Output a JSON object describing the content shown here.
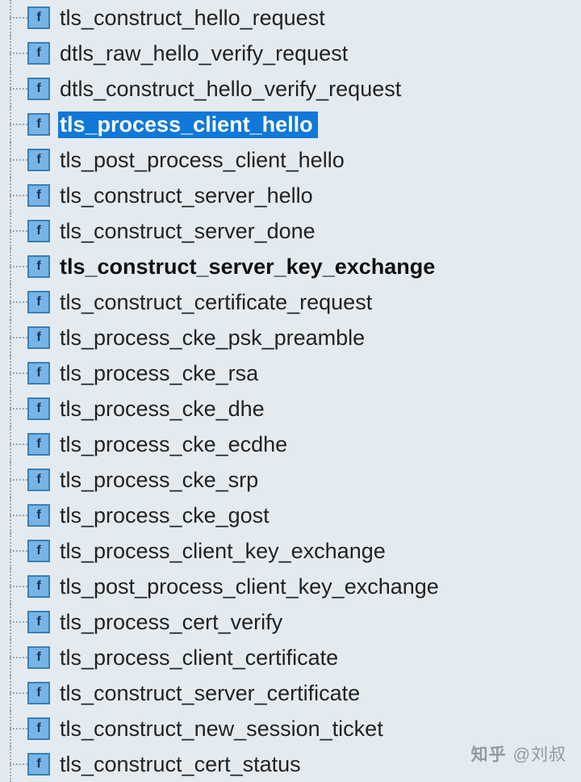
{
  "tree": {
    "items": [
      {
        "label": "tls_construct_hello_request",
        "selected": false,
        "bold": false
      },
      {
        "label": "dtls_raw_hello_verify_request",
        "selected": false,
        "bold": false
      },
      {
        "label": "dtls_construct_hello_verify_request",
        "selected": false,
        "bold": false
      },
      {
        "label": "tls_process_client_hello",
        "selected": true,
        "bold": true
      },
      {
        "label": "tls_post_process_client_hello",
        "selected": false,
        "bold": false
      },
      {
        "label": "tls_construct_server_hello",
        "selected": false,
        "bold": false
      },
      {
        "label": "tls_construct_server_done",
        "selected": false,
        "bold": false
      },
      {
        "label": "tls_construct_server_key_exchange",
        "selected": false,
        "bold": true
      },
      {
        "label": "tls_construct_certificate_request",
        "selected": false,
        "bold": false
      },
      {
        "label": "tls_process_cke_psk_preamble",
        "selected": false,
        "bold": false
      },
      {
        "label": "tls_process_cke_rsa",
        "selected": false,
        "bold": false
      },
      {
        "label": "tls_process_cke_dhe",
        "selected": false,
        "bold": false
      },
      {
        "label": "tls_process_cke_ecdhe",
        "selected": false,
        "bold": false
      },
      {
        "label": "tls_process_cke_srp",
        "selected": false,
        "bold": false
      },
      {
        "label": "tls_process_cke_gost",
        "selected": false,
        "bold": false
      },
      {
        "label": "tls_process_client_key_exchange",
        "selected": false,
        "bold": false
      },
      {
        "label": "tls_post_process_client_key_exchange",
        "selected": false,
        "bold": false
      },
      {
        "label": "tls_process_cert_verify",
        "selected": false,
        "bold": false
      },
      {
        "label": "tls_process_client_certificate",
        "selected": false,
        "bold": false
      },
      {
        "label": "tls_construct_server_certificate",
        "selected": false,
        "bold": false
      },
      {
        "label": "tls_construct_new_session_ticket",
        "selected": false,
        "bold": false
      },
      {
        "label": "tls_construct_cert_status",
        "selected": false,
        "bold": false
      }
    ]
  },
  "watermark": {
    "logo": "知乎",
    "text": "@刘叔"
  }
}
